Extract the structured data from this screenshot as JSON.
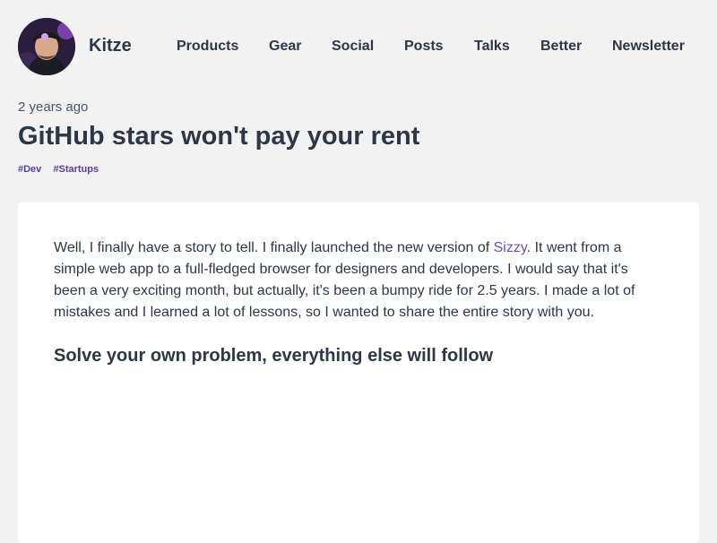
{
  "site": {
    "brand": "Kitze",
    "avatar_icon": "profile-photo-icon"
  },
  "nav": {
    "items": [
      {
        "label": "Products"
      },
      {
        "label": "Gear"
      },
      {
        "label": "Social"
      },
      {
        "label": "Posts"
      },
      {
        "label": "Talks"
      },
      {
        "label": "Better"
      },
      {
        "label": "Newsletter"
      }
    ]
  },
  "post": {
    "date": "2 years ago",
    "title": "GitHub stars won't pay your rent",
    "tags": [
      "#Dev",
      "#Startups"
    ],
    "intro_before_link": "Well, I finally have a story to tell. I finally launched the new version of ",
    "intro_link": "Sizzy",
    "intro_after_link": ". It went from a simple web app to a full-fledged browser for designers and developers. I would say that it's been a very exciting month, but actually, it's been a bumpy ride for 2.5 years. I made a lot of mistakes and I learned a lot of lessons, so I wanted to share the entire story with you.",
    "section_heading": "Solve your own problem, everything else will follow"
  },
  "colors": {
    "background": "#f2f2f2",
    "text": "#2d3748",
    "link": "#6b4fbb",
    "tag": "#5b3f9a",
    "card": "#ffffff"
  }
}
